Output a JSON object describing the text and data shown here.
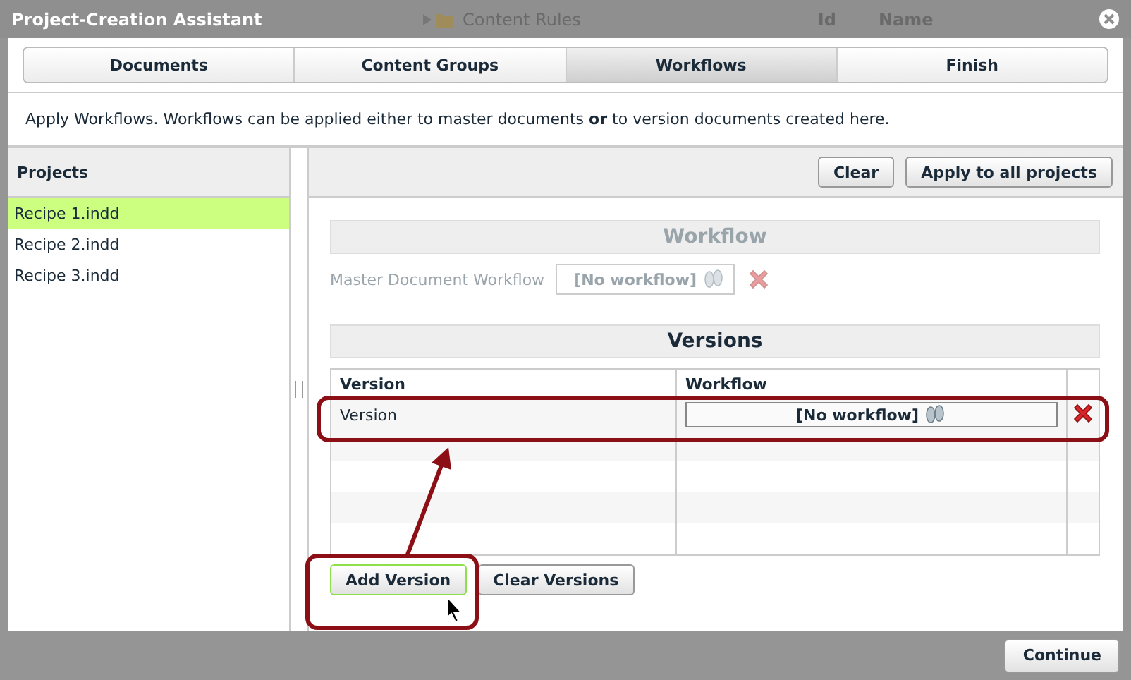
{
  "background": {
    "folder_label": "Content Rules",
    "column_1": "Id",
    "column_2": "Name"
  },
  "window": {
    "title": "Project-Creation Assistant"
  },
  "steps": [
    {
      "label": "Documents",
      "selected": false
    },
    {
      "label": "Content Groups",
      "selected": false
    },
    {
      "label": "Workflows",
      "selected": true
    },
    {
      "label": "Finish",
      "selected": false
    }
  ],
  "intro": "Apply Workflows. Workflows can be applied either to master documents **or** to version documents created here.",
  "projects": {
    "title": "Projects",
    "items": [
      {
        "label": "Recipe 1.indd",
        "selected": true
      },
      {
        "label": "Recipe 2.indd",
        "selected": false
      },
      {
        "label": "Recipe 3.indd",
        "selected": false
      }
    ]
  },
  "toolbar": {
    "buttons": [
      "Clear",
      "Apply to all projects"
    ]
  },
  "workflow_section": {
    "title": "Workflow",
    "disabled": true,
    "label": "Master Document Workflow",
    "value": "[No workflow]"
  },
  "versions": {
    "title": "Versions",
    "columns": [
      "Version",
      "Workflow"
    ],
    "rows": [
      {
        "version": "Version",
        "workflow": "[No workflow]"
      }
    ],
    "buttons": [
      {
        "label": "Add Version",
        "focused": true
      },
      {
        "label": "Clear Versions",
        "focused": false
      }
    ]
  },
  "footer": {
    "button": "Continue"
  }
}
